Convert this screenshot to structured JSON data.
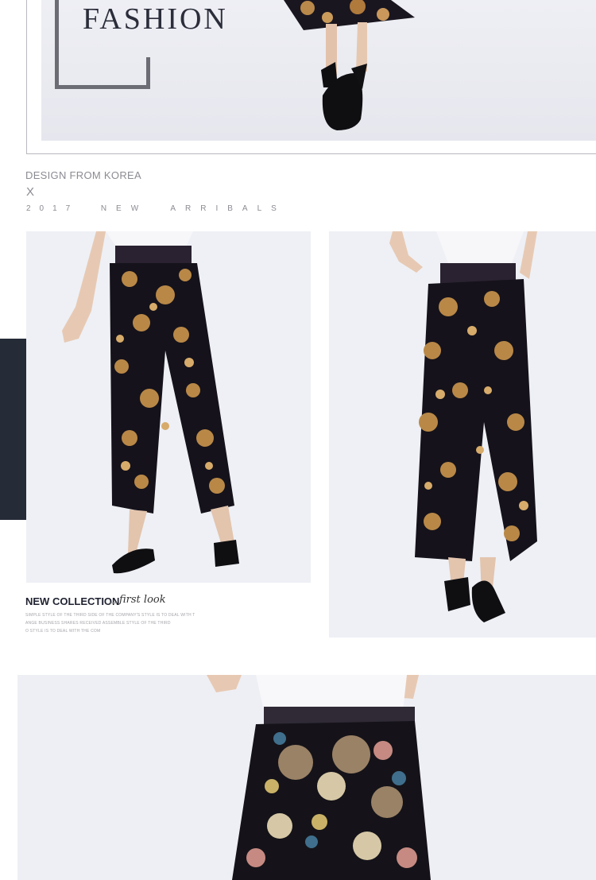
{
  "hero": {
    "title": "FASHION"
  },
  "taglines": {
    "origin": "DESIGN FROM KOREA",
    "mark": "X",
    "year": "2017",
    "arrivals": "NEW ARRIBALS"
  },
  "caption": {
    "heading": "NEW COLLECTION",
    "script": "first look",
    "fine_print": [
      "SIMPLE STYLE OF THE THIRD SIDE OF THE COMPANY'S STYLE IS TO DEAL WITH T",
      "ANGE BUSINESS SHARES RECEIVED ASSEMBLE STYLE OF THE THIRD",
      "O STYLE IS TO DEAL WITH THE COM"
    ]
  },
  "colors": {
    "accent_dark": "#262b38",
    "frame_gray": "#6c6c74",
    "text_gray": "#8b8b93"
  }
}
